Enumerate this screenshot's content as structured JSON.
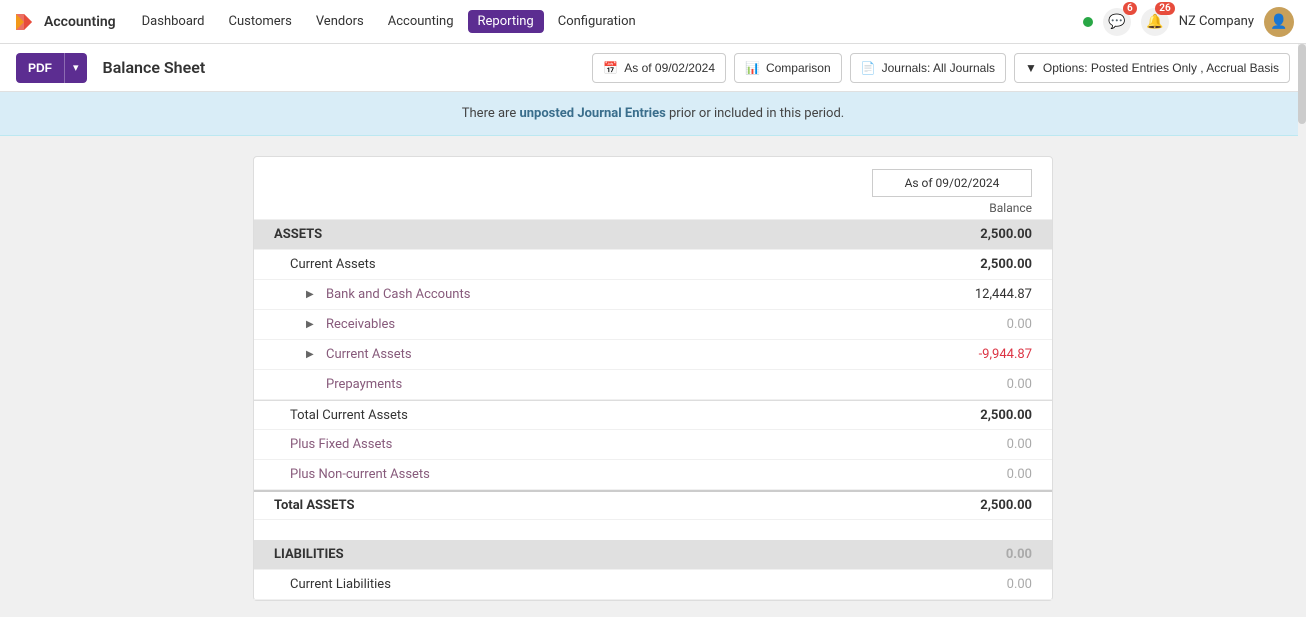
{
  "app": {
    "logo": "✖",
    "name": "Accounting",
    "nav_links": [
      {
        "id": "dashboard",
        "label": "Dashboard",
        "active": false
      },
      {
        "id": "customers",
        "label": "Customers",
        "active": false
      },
      {
        "id": "vendors",
        "label": "Vendors",
        "active": false
      },
      {
        "id": "accounting",
        "label": "Accounting",
        "active": false
      },
      {
        "id": "reporting",
        "label": "Reporting",
        "active": true
      },
      {
        "id": "configuration",
        "label": "Configuration",
        "active": false
      }
    ]
  },
  "nav_right": {
    "company": "NZ Company",
    "msg_badge": "6",
    "alert_badge": "26"
  },
  "toolbar": {
    "pdf_label": "PDF",
    "page_title": "Balance Sheet",
    "filters": [
      {
        "id": "date",
        "icon": "📅",
        "label": "As of 09/02/2024"
      },
      {
        "id": "comparison",
        "icon": "📊",
        "label": "Comparison"
      },
      {
        "id": "journals",
        "icon": "📄",
        "label": "Journals: All Journals"
      },
      {
        "id": "options",
        "icon": "▼",
        "label": "Options: Posted Entries Only , Accrual Basis"
      }
    ]
  },
  "warning": {
    "prefix": "There are ",
    "highlight": "unposted Journal Entries",
    "suffix": " prior or included in this period."
  },
  "report": {
    "date_header": "As of 09/02/2024",
    "balance_label": "Balance",
    "sections": [
      {
        "type": "section-header",
        "label": "ASSETS",
        "value": "2,500.00",
        "value_class": "bold"
      },
      {
        "type": "subtotal",
        "label": "Current Assets",
        "value": "2,500.00",
        "value_class": "bold",
        "indent": 1
      },
      {
        "type": "expandable",
        "label": "Bank and Cash Accounts",
        "value": "12,444.87",
        "value_class": "",
        "indent": 2,
        "link": true
      },
      {
        "type": "expandable",
        "label": "Receivables",
        "value": "0.00",
        "value_class": "muted",
        "indent": 2,
        "link": true
      },
      {
        "type": "expandable",
        "label": "Current Assets",
        "value": "-9,944.87",
        "value_class": "negative",
        "indent": 2,
        "link": true
      },
      {
        "type": "normal",
        "label": "Prepayments",
        "value": "0.00",
        "value_class": "muted",
        "indent": 2,
        "link": true
      },
      {
        "type": "subtotal",
        "label": "Total Current Assets",
        "value": "2,500.00",
        "value_class": "bold",
        "indent": 1
      },
      {
        "type": "normal",
        "label": "Plus Fixed Assets",
        "value": "0.00",
        "value_class": "muted",
        "indent": 1,
        "link": true
      },
      {
        "type": "normal",
        "label": "Plus Non-current Assets",
        "value": "0.00",
        "value_class": "muted",
        "indent": 1,
        "link": true
      },
      {
        "type": "total",
        "label": "Total ASSETS",
        "value": "2,500.00",
        "value_class": "bold",
        "indent": 0
      },
      {
        "type": "spacer"
      },
      {
        "type": "section-header",
        "label": "LIABILITIES",
        "value": "0.00",
        "value_class": "muted"
      },
      {
        "type": "subtotal",
        "label": "Current Liabilities",
        "value": "0.00",
        "value_class": "muted",
        "indent": 1
      }
    ]
  }
}
